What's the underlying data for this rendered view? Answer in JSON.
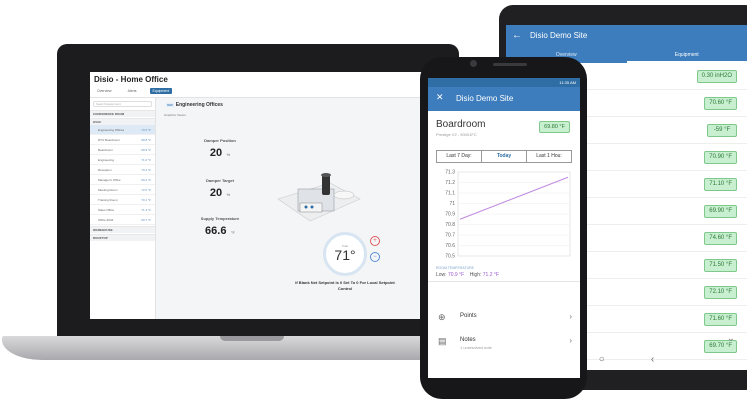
{
  "laptop": {
    "app_title": "Disio - Home Office",
    "tabs": [
      "Overview",
      "Alerts",
      "Equipment"
    ],
    "active_tab_index": 2,
    "sidebar": {
      "search_placeholder": "Search Equipment",
      "groups": [
        "CONFERENCE ROOM",
        "HVAC",
        "WAREHOUSE",
        "ROOFTOP"
      ],
      "rows": [
        {
          "label": "Engineering Offices",
          "value": "70.5 °F"
        },
        {
          "label": "RTU Boardroom",
          "value": "68.8 °F"
        },
        {
          "label": "Boardroom",
          "value": "69.9 °F"
        },
        {
          "label": "Engineering",
          "value": "71.0 °F"
        },
        {
          "label": "Reception",
          "value": "70.4 °F"
        },
        {
          "label": "Manager's Office",
          "value": "69.2 °F"
        },
        {
          "label": "Meeting Room",
          "value": "72.0 °F"
        },
        {
          "label": "Training Room",
          "value": "70.1 °F"
        },
        {
          "label": "Sales Office",
          "value": "71.3 °F"
        },
        {
          "label": "Office #204",
          "value": "69.7 °F"
        }
      ]
    },
    "equipment": {
      "name": "Engineering Offices",
      "graphics_label": "Graphics Viewer"
    },
    "metrics": [
      {
        "label": "Damper Position",
        "value": "20",
        "unit": "%"
      },
      {
        "label": "Damper Target",
        "value": "20",
        "unit": "%"
      },
      {
        "label": "Supply Temperature",
        "value": "66.6",
        "unit": "°F"
      }
    ],
    "thermostat": {
      "label": "Tstat",
      "value": "71°"
    },
    "setpoint_note": "If Blank Net Setpoint Is 0 Set To 0 For Local Setpoint Control"
  },
  "tablet": {
    "title": "Disio Demo Site",
    "tabs": [
      "Overview",
      "Equipment"
    ],
    "active_tab_index": 1,
    "values": [
      "0.30 inH2O",
      "70.60 °F",
      "-59 °F",
      "70.90 °F",
      "71.10 °F",
      "69.90 °F",
      "74.60 °F",
      "71.50 °F",
      "72.10 °F",
      "71.60 °F",
      "69.70 °F"
    ]
  },
  "phone": {
    "status_time": "11:35 AM",
    "app_title": "Disio Demo Site",
    "equipment_name": "Boardroom",
    "equipment_sub": "Prestige V2 - 90001FC",
    "current_value": "69.80 °F",
    "range_buttons": [
      "Last 7 Day:",
      "Today",
      "Last 1 Hou:"
    ],
    "active_range_index": 1,
    "chart_legend": "ROOM TEMPERATURE",
    "low_label": "Low:",
    "low_value": "70.9 °F",
    "high_label": "High:",
    "high_value": "71.2 °F",
    "points_label": "Points",
    "notes_label": "Notes",
    "notes_sub": "1 unresolved note"
  },
  "chart_data": {
    "type": "line",
    "title": "",
    "xlabel": "",
    "ylabel": "",
    "y_ticks": [
      71.3,
      71.2,
      71.1,
      71.0,
      70.9,
      70.8,
      70.7,
      70.6,
      70.5
    ],
    "ylim": [
      70.5,
      71.3
    ],
    "series": [
      {
        "name": "ROOM TEMPERATURE",
        "x": [
          0,
          1
        ],
        "values": [
          70.85,
          71.25
        ]
      }
    ],
    "grid": true,
    "line_color": "#c08adf"
  },
  "colors": {
    "brand_blue": "#3d7dbd",
    "badge_green": "#c8efcf"
  }
}
